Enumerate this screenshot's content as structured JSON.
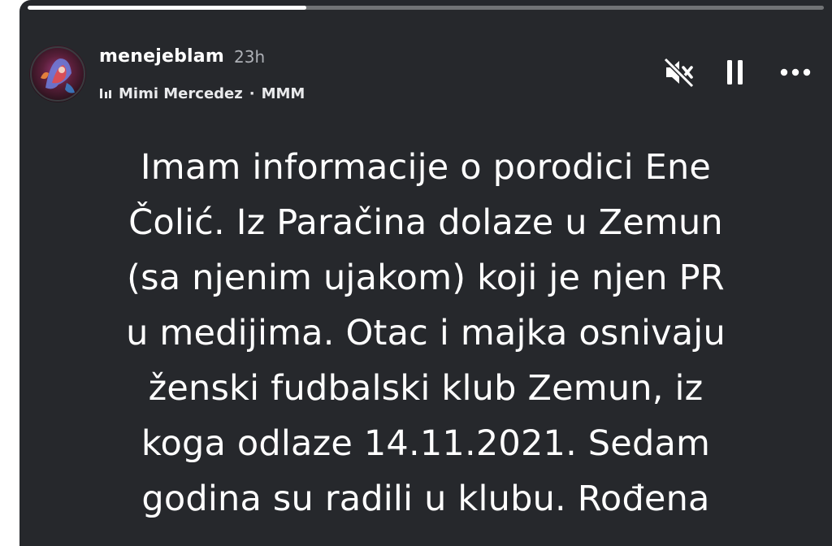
{
  "story": {
    "progress": 0.35,
    "account": {
      "username": "menejeblam",
      "time": "23h",
      "avatar_icon": "avatar-image"
    },
    "music": {
      "icon": "music-bars-icon",
      "artist": "Mimi Mercedez",
      "separator": "·",
      "album": "MMM"
    },
    "controls": {
      "mute_icon": "speaker-muted-icon",
      "pause_icon": "pause-icon",
      "more_icon": "more-options-icon"
    },
    "caption_lines": [
      "Imam informacije o porodici Ene",
      "Čolić. Iz Paračina dolaze u Zemun",
      "(sa njenim ujakom) koji je njen PR",
      "u medijima. Otac i majka osnivaju",
      "ženski fudbalski klub Zemun, iz",
      "koga odlaze 14.11.2021. Sedam",
      "godina su radili u klubu. Rođena"
    ],
    "colors": {
      "background": "#26282c",
      "text": "#ffffff",
      "muted_text": "#aeb1b7"
    }
  }
}
